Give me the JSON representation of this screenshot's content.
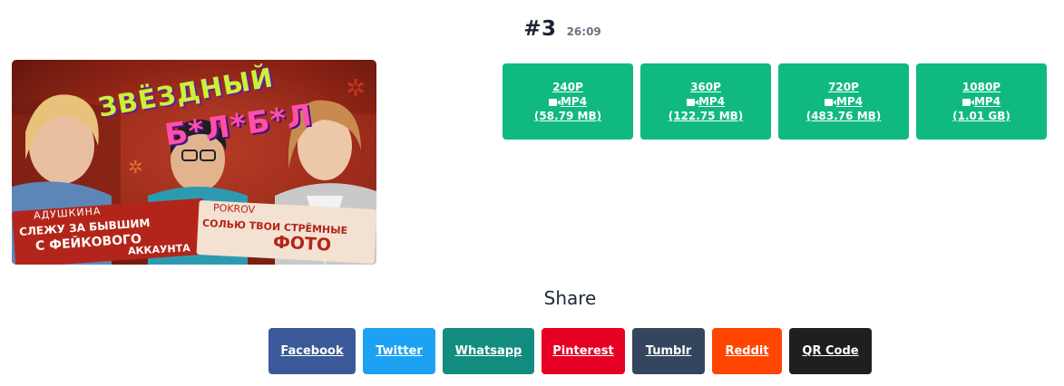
{
  "video": {
    "title": "#3",
    "duration": "26:09",
    "thumbnail_text": {
      "show_title_line1": "ЗВЁЗДНЫЙ",
      "show_title_line2": "Б*Л*Б*Л",
      "guest1_name": "АДУШКИНА",
      "guest1_line1": "СЛЕЖУ ЗА БЫВШИМ",
      "guest1_line2": "С ФЕЙКОВОГО",
      "guest1_line3": "АККАУНТА",
      "guest2_name": "POKROV",
      "guest2_line1": "СОЛЬЮ ТВОИ СТРЁМНЫЕ",
      "guest2_line2": "ФОТО"
    }
  },
  "downloads": [
    {
      "quality": "240P",
      "format": "MP4",
      "size": "(58.79 MB)",
      "icon": "video-camera-icon"
    },
    {
      "quality": "360P",
      "format": "MP4",
      "size": "(122.75 MB)",
      "icon": "video-camera-icon"
    },
    {
      "quality": "720P",
      "format": "MP4",
      "size": "(483.76 MB)",
      "icon": "video-camera-icon"
    },
    {
      "quality": "1080P",
      "format": "MP4",
      "size": "(1.01 GB)",
      "icon": "video-camera-icon"
    }
  ],
  "share": {
    "label": "Share",
    "buttons": [
      {
        "label": "Facebook",
        "color": "#3b5998"
      },
      {
        "label": "Twitter",
        "color": "#1da1f2"
      },
      {
        "label": "Whatsapp",
        "color": "#128c7e"
      },
      {
        "label": "Pinterest",
        "color": "#e60023"
      },
      {
        "label": "Tumblr",
        "color": "#34465d"
      },
      {
        "label": "Reddit",
        "color": "#ff4500"
      },
      {
        "label": "QR Code",
        "color": "#1f1f1f"
      }
    ]
  },
  "colors": {
    "download_button": "#10b981",
    "title": "#1a2233",
    "duration": "#6b7280"
  }
}
